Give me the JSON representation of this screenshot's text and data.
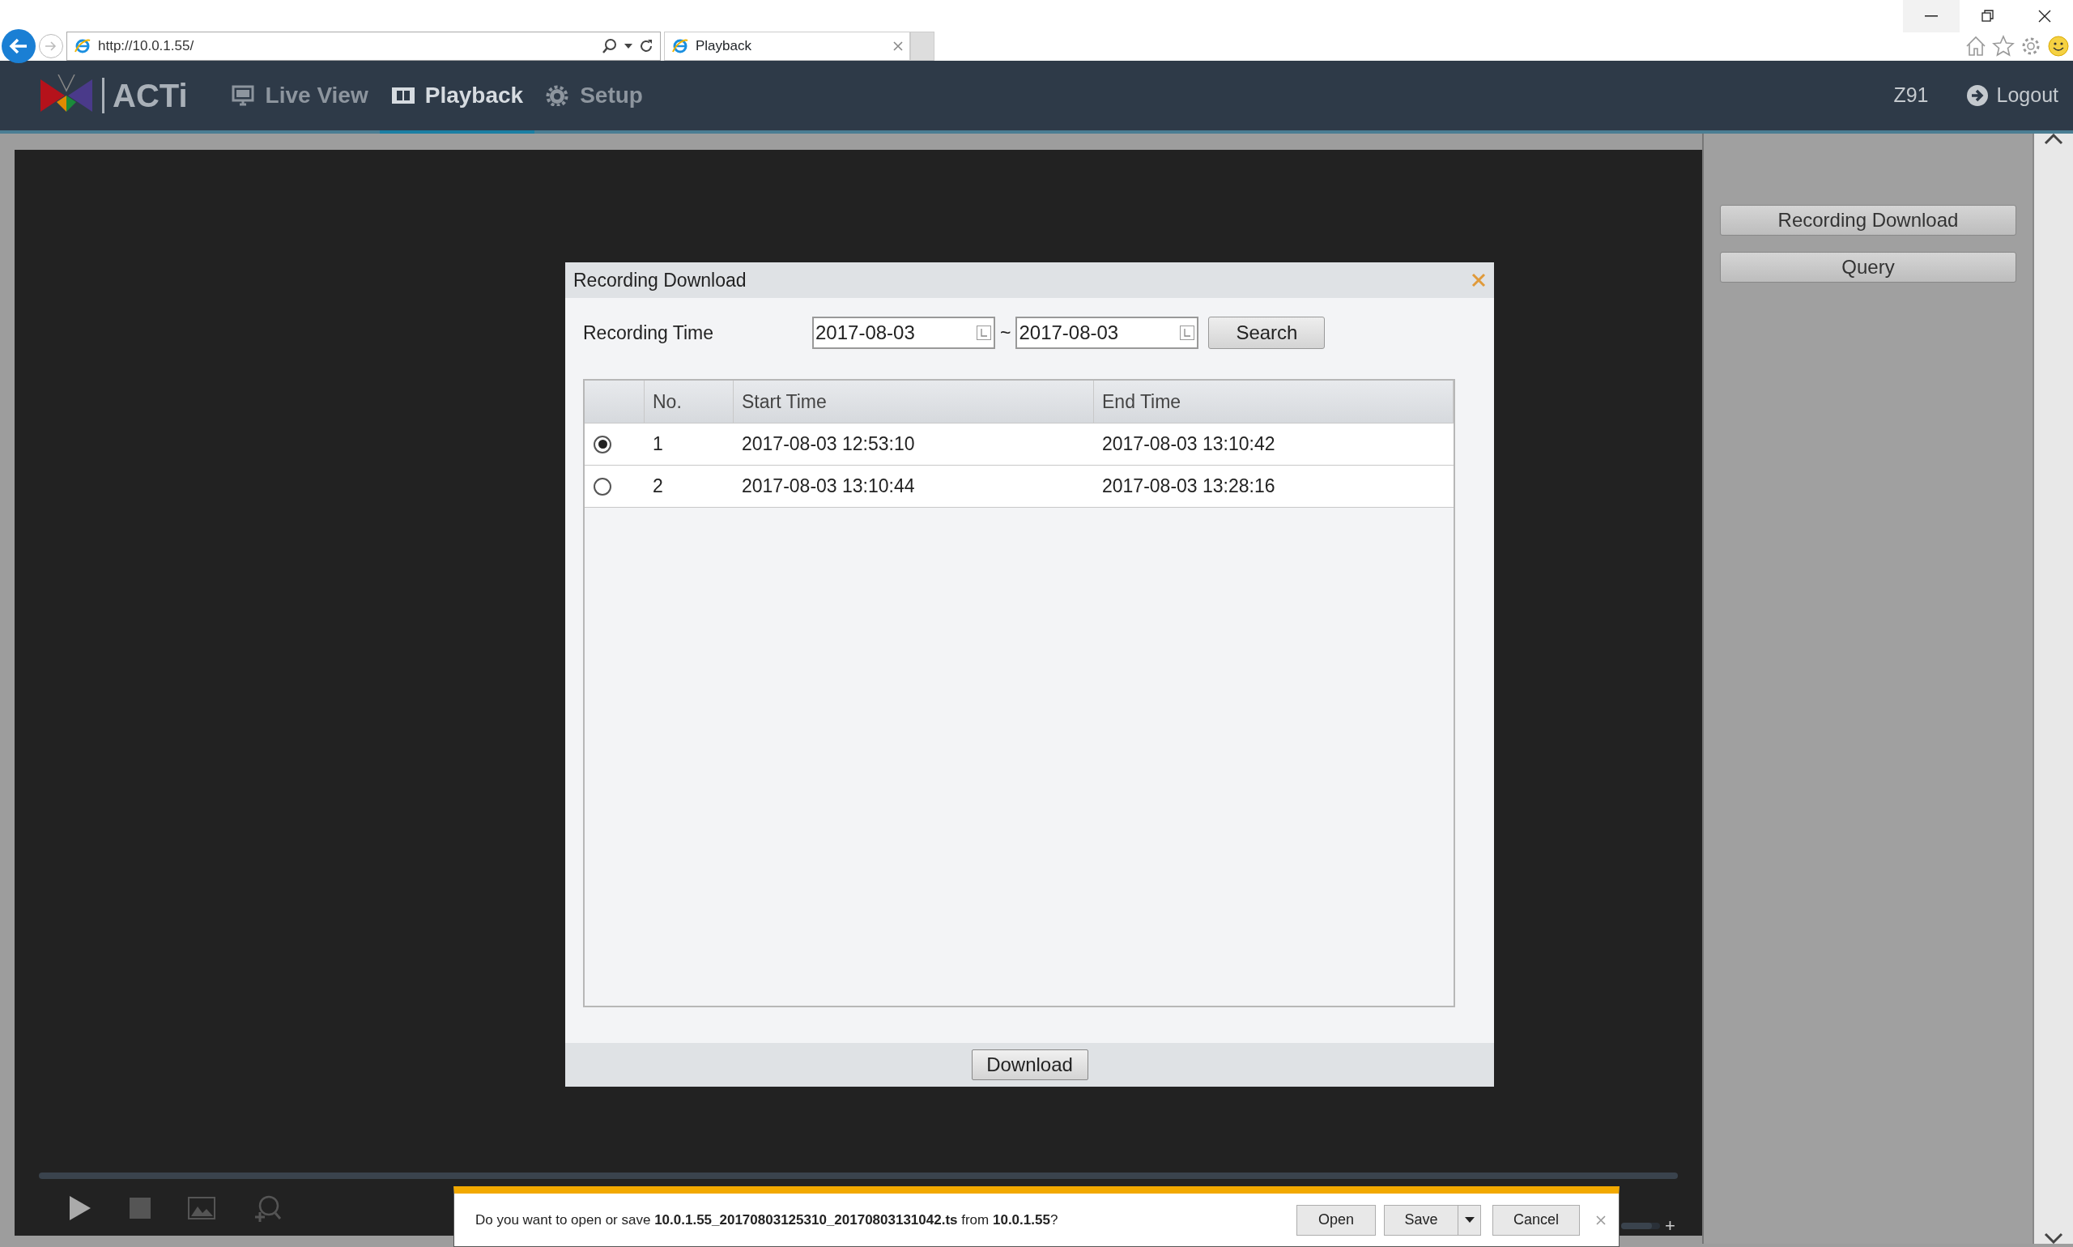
{
  "browser": {
    "address": "http://10.0.1.55/",
    "tab_title": "Playback"
  },
  "navbar": {
    "logo": "ACTi",
    "tabs": [
      {
        "label": "Live View",
        "selected": false,
        "kind": "monitor"
      },
      {
        "label": "Playback",
        "selected": true,
        "kind": "film"
      },
      {
        "label": "Setup",
        "selected": false,
        "kind": "gear"
      }
    ],
    "user": "Z91",
    "logout": "Logout"
  },
  "side_buttons": [
    "Recording Download",
    "Query"
  ],
  "player": {
    "volume": {
      "level": 0.8
    },
    "volume_plus": "+"
  },
  "dialog": {
    "title": "Recording Download",
    "time_label": "Recording Time",
    "start_date": "2017-08-03",
    "separator": "~",
    "end_date": "2017-08-03",
    "search": "Search",
    "columns": [
      "No.",
      "Start Time",
      "End Time"
    ],
    "rows": [
      {
        "no": "1",
        "start": "2017-08-03 12:53:10",
        "end": "2017-08-03 13:10:42",
        "selected": true
      },
      {
        "no": "2",
        "start": "2017-08-03 13:10:44",
        "end": "2017-08-03 13:28:16",
        "selected": false
      }
    ],
    "download": "Download"
  },
  "download_bar": {
    "message": "Do you want to open or save **10.0.1.55_20170803125310_20170803131042.ts** from **10.0.1.55**?",
    "buttons": [
      "Open",
      "Save",
      "Cancel"
    ]
  }
}
